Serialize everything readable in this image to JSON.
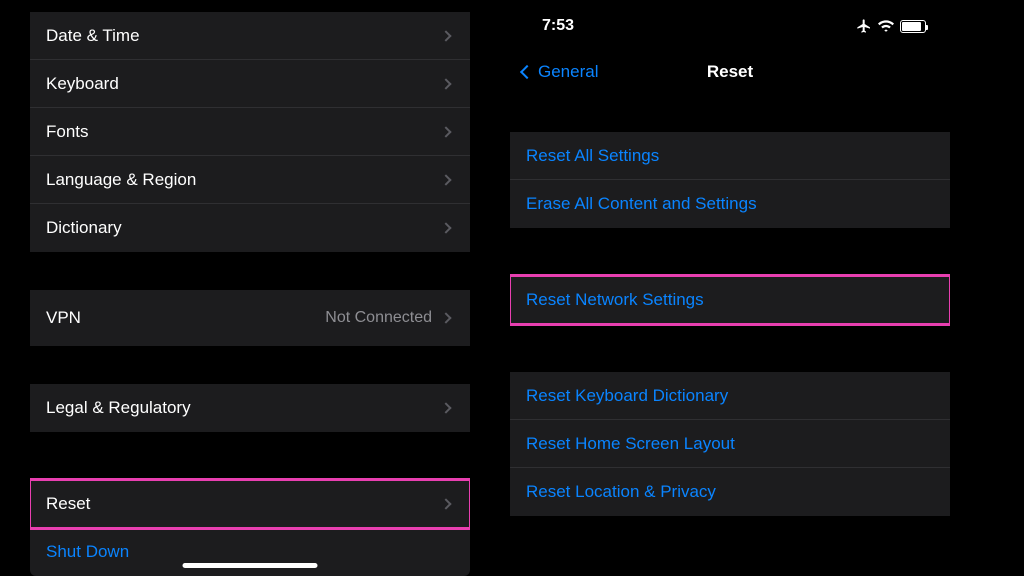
{
  "left": {
    "items": [
      {
        "label": "Date & Time"
      },
      {
        "label": "Keyboard"
      },
      {
        "label": "Fonts"
      },
      {
        "label": "Language & Region"
      },
      {
        "label": "Dictionary"
      }
    ],
    "vpn_label": "VPN",
    "vpn_status": "Not Connected",
    "legal_label": "Legal & Regulatory",
    "reset_label": "Reset",
    "shutdown_label": "Shut Down"
  },
  "right": {
    "time": "7:53",
    "back_label": "General",
    "title": "Reset",
    "group1": [
      "Reset All Settings",
      "Erase All Content and Settings"
    ],
    "highlight": "Reset Network Settings",
    "group3": [
      "Reset Keyboard Dictionary",
      "Reset Home Screen Layout",
      "Reset Location & Privacy"
    ]
  },
  "colors": {
    "accent": "#0a84ff",
    "highlight": "#e83fb0"
  }
}
